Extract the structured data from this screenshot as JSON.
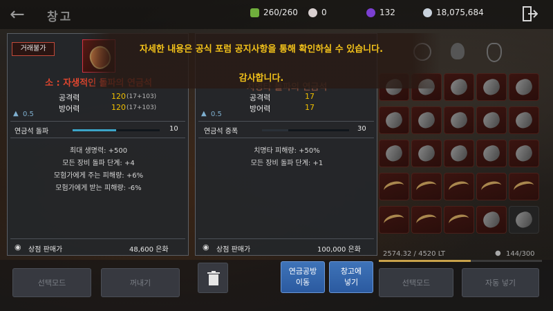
{
  "header": {
    "back_icon": "arrow-left-icon",
    "title": "창고",
    "currencies": [
      {
        "icon": "energy-icon",
        "value": "260/260",
        "color": "#6fae3c"
      },
      {
        "icon": "pearl-icon",
        "value": "0",
        "color": "#d9d0d0"
      },
      {
        "icon": "crystal-icon",
        "value": "132",
        "color": "#7b3fd1"
      },
      {
        "icon": "silver-icon",
        "value": "18,075,684",
        "color": "#c9d2dc"
      }
    ],
    "exit_icon": "exit-icon"
  },
  "notice": {
    "line1": "자세한 내용은 공식 포럼 공지사항을 통해 확인하실 수 있습니다.",
    "line2": "감사합니다."
  },
  "left_tooltip": {
    "tradeable_badge": "거래불가",
    "item_name": "소 : 자생적인 돌파의 연금석",
    "stats": [
      {
        "name": "공격력",
        "value": "120",
        "detail": "(17+103)"
      },
      {
        "name": "방어력",
        "value": "120",
        "detail": "(17+103)"
      }
    ],
    "weight": "0.5",
    "level_label": "연금석 돌파",
    "level_value": "10",
    "level_fill": 0.5,
    "effects": [
      "최대 생명력: +500",
      "모든 장비 돌파 단계: +4",
      "모험가에게 주는 피해량: +6%",
      "모험가에게 받는 피해량: -6%"
    ],
    "sell_label": "상점 판매가",
    "sell_value": "48,600 은화"
  },
  "right_tooltip": {
    "item_name": "치명타 돌파의 연금석",
    "stats": [
      {
        "name": "공격력",
        "value": "17"
      },
      {
        "name": "방어력",
        "value": "17"
      }
    ],
    "weight": "0.5",
    "level_label": "연금석 증폭",
    "level_value": "30",
    "level_fill": 0.3,
    "effects": [
      "치명타 피해량: +50%",
      "모든 장비 돌파 단계: +1"
    ],
    "sell_label": "상점 판매가",
    "sell_value": "100,000 은화",
    "move_button": "연금공방\n이동",
    "store_button": "창고에\n넣기"
  },
  "bottom": {
    "left_select_mode": "선택모드",
    "take_out": "꺼내기",
    "right_select_mode": "선택모드",
    "auto_store": "자동 넣기",
    "weight_readout": "2574.32 / 4520 LT",
    "slot_count": "144/300"
  }
}
